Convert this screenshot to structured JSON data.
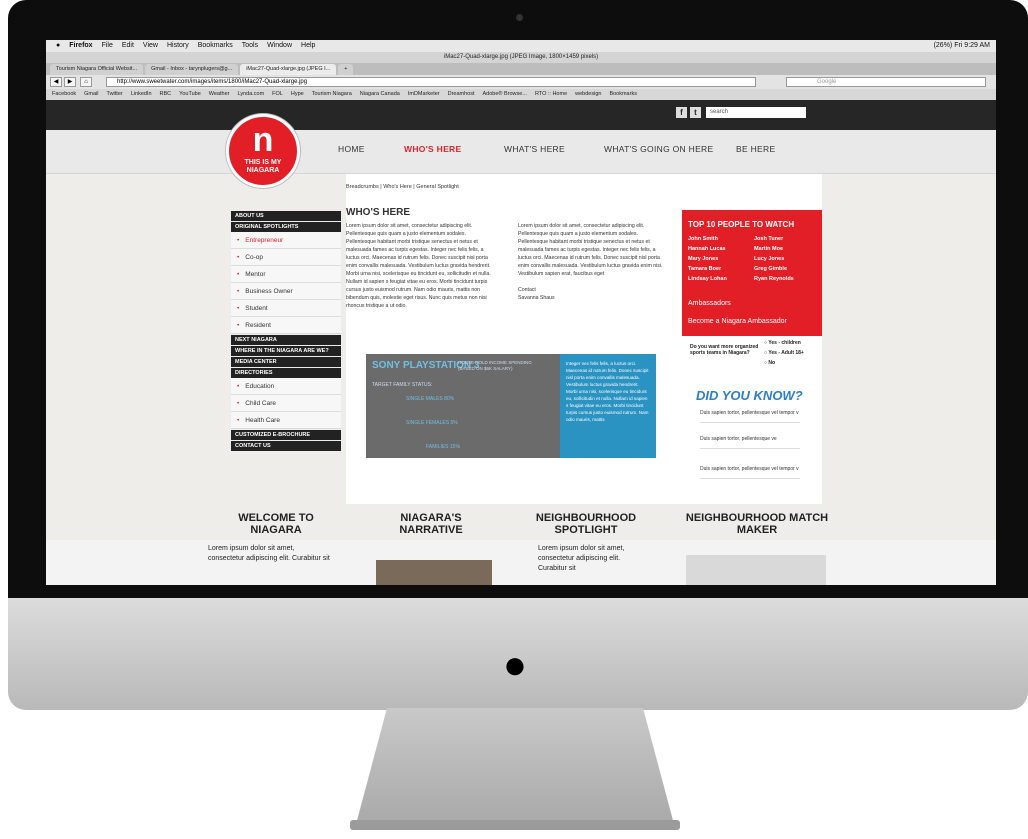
{
  "menubar": {
    "app": "Firefox",
    "items": [
      "File",
      "Edit",
      "View",
      "History",
      "Bookmarks",
      "Tools",
      "Window",
      "Help"
    ],
    "status": "(26%)  Fri 9:29 AM"
  },
  "window_title": "iMac27-Quad-xlarge.jpg (JPEG Image, 1800×1459 pixels)",
  "tabs": [
    "Tourism Niagara Official Websit...",
    "Gmail - Inbox - tarynplugers@g...",
    "iMac27-Quad-xlarge.jpg (JPEG I..."
  ],
  "address": "http://www.sweetwater.com/images/items/1800/iMac27-Quad-xlarge.jpg",
  "search_placeholder": "Google",
  "bookmarks": [
    "Facebook",
    "Gmail",
    "Twitter",
    "LinkedIn",
    "RBC",
    "YouTube",
    "Weather",
    "Lynda.com",
    "FOL",
    "Hype",
    "Tourism Niagara",
    "Niagara Canada",
    "ImDMarketer",
    "Dreamhost",
    "Adobe® Browse...",
    "RTO :: Home",
    "webdesign",
    "Bookmarks"
  ],
  "site": {
    "search_placeholder": "search",
    "logo_text": "THIS IS MY NIAGARA",
    "nav": [
      "HOME",
      "WHO'S HERE",
      "WHAT'S HERE",
      "WHAT'S GOING ON HERE",
      "BE HERE"
    ],
    "leftnav": {
      "about": "ABOUT US",
      "original": "ORIGINAL SPOTLIGHTS",
      "spot_items": [
        "Entrepreneur",
        "Co-op",
        "Mentor",
        "Business Owner",
        "Student",
        "Resident"
      ],
      "next": "NEXT NIAGARA",
      "where": "WHERE IN THE NIAGARA ARE WE?",
      "media": "MEDIA CENTER",
      "directories": "DIRECTORIES",
      "dir_items": [
        "Education",
        "Child Care",
        "Health Care"
      ],
      "brochure": "CUSTOMIZED E-BROCHURE",
      "contact": "CONTACT US"
    },
    "breadcrumb": "Breadcrumbs | Who's Here | General Spotlight",
    "heading": "WHO'S HERE",
    "col1": "Lorem ipsum dolor sit amet, consectetur adipiscing elit. Pellentesque quis quam a justo elementum sodales. Pellentesque habitant morbi tristique senectus et netus et malesuada fames ac turpis egestas. Integer nec felis felis, a luctus orci. Maecenas id rutrum felis. Donec suscipit nisl porta enim convallis malesuada. Vestibulum luctus gravida hendrerit. Morbi urna nisi, scelerisque eu tincidunt eu, sollicitudin et nulla. Nullam id sapien s feugiat vitae eu eros. Morbi tincidunt turpis cursus justo euismod rutrum. Nam odio mauris, mattis non bibendum quis, molestie eget risus. Nunc quis metus non nisi rhoncus tristique a ut odio.",
    "col2": "Lorem ipsum dolor sit amet, consectetur adipiscing elit. Pellentesque quis quam a justo elementum sodales. Pellentesque habitant morbi tristique senectus et netus et malesuada fames ac turpis egestas. Integer nec felis felis, a luctus orci. Maecenas id rutrum felis. Donec suscipit nisl porta enim convallis malesuada. Vestibulum luctus gravida enim nisi. Vestibulum sapien erat, faucibus eget",
    "contact_label": "Contact",
    "contact_name": "Savanna Shaus",
    "infographic": {
      "title": "SONY PLAYSTATION 3",
      "subtitle": "HOUSE HOLD INCOME SPENDING (BASED ON $6K SALARY)",
      "family": "TARGET FAMILY STATUS:",
      "stat1": "SINGLE MALES 80%",
      "stat2": "SINGLE FEMALES 5%",
      "stat3": "FAMILIES 15%",
      "blue_text": "Integer nec felis felis, a luctus orci. Maecenas id rutrum felis. Donec suscipit nisl porta enim convallis malesuada. Vestibulum luctus gravida hendrerit. Morbi urna nisi, scelerisque eu tincidunt eu, sollicitudin et nulla. Nullam id sapien s feugiat vitae eu eros. Morbi tincidunt turpis cursus justo euismod rutrum. Nam odio mauris, mattis"
    },
    "top10": {
      "heading": "TOP 10 PEOPLE TO WATCH",
      "left": [
        "John Smith",
        "Hannah Lucas",
        "Mary Jones",
        "Tamara Boer",
        "Lindsay Lohan"
      ],
      "right": [
        "Josh Tuner",
        "Martin Moe",
        "Lucy Jones",
        "Greg Gimble",
        "Ryan Reynolds"
      ],
      "ambassadors": "Ambassadors",
      "become": "Become a Niagara Ambassador"
    },
    "poll": {
      "question": "Do you want more organized sports teams in Niagara?",
      "options": [
        "Yes - children",
        "Yes - Adult 18+",
        "No"
      ]
    },
    "dyk": {
      "heading": "DID YOU KNOW?",
      "items": [
        "Duis sapien tortor, pellentesque vel tempor v",
        "Duis sapien tortor, pellentesque ve",
        "Duis sapien tortor, pellentesque vel tempor v"
      ]
    },
    "sections": [
      "WELCOME TO NIAGARA",
      "NIAGARA'S NARRATIVE",
      "NEIGHBOURHOOD SPOTLIGHT",
      "NEIGHBOURHOOD MATCH MAKER"
    ],
    "welcome_text": "Lorem ipsum dolor sit amet, consectetur adipiscing elit. Curabitur sit",
    "spotlight_text": "Lorem ipsum dolor sit amet, consectetur adipiscing elit. Curabitur sit"
  }
}
